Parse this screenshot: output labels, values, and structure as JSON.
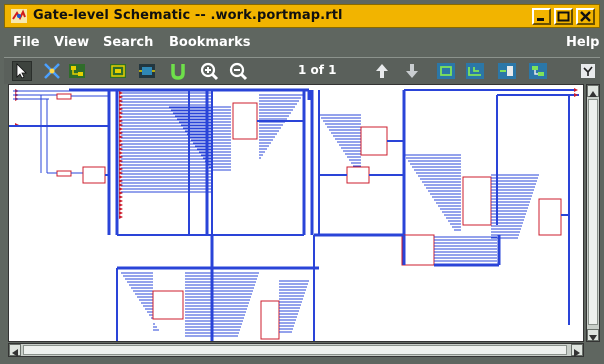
{
  "window": {
    "title": "Gate-level Schematic -- .work.portmap.rtl"
  },
  "menu": {
    "file": "File",
    "view": "View",
    "search": "Search",
    "bookmarks": "Bookmarks",
    "help": "Help"
  },
  "toolbar": {
    "page_indicator": "1 of 1"
  },
  "colors": {
    "titlebar": "#f2b400",
    "chrome": "#5f6660",
    "wire": "#2a44d8",
    "component": "#cc1c2c",
    "toolbar_icon_green": "#3fbf3a",
    "toolbar_icon_yellow": "#e6d000",
    "canvas_bg": "#ffffff"
  },
  "icons": [
    "schematic-app-icon",
    "minimize-icon",
    "maximize-icon",
    "close-icon",
    "select-arrow-icon",
    "unmark-icon",
    "hierarchy-icon",
    "instance-icon",
    "module-icon",
    "unroute-icon",
    "zoom-in-icon",
    "zoom-out-icon",
    "previous-page-icon",
    "next-page-icon",
    "fit-view-icon",
    "push-icon",
    "pop-icon",
    "expand-icon",
    "pin-icon"
  ]
}
